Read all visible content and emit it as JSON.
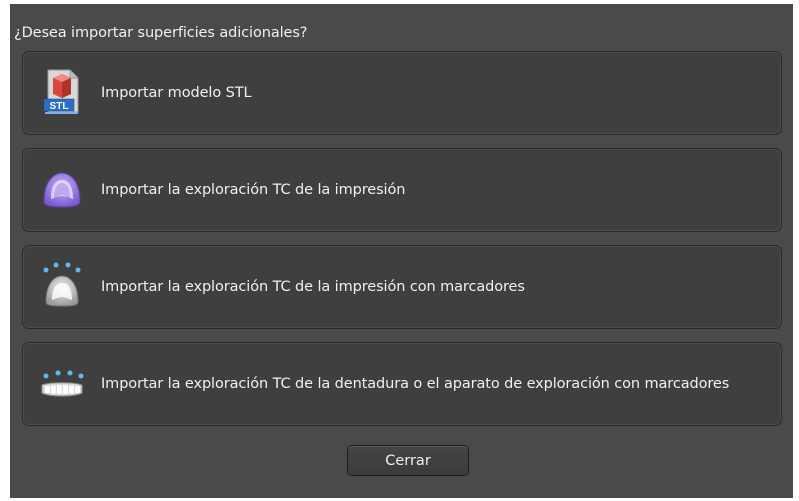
{
  "dialog": {
    "question": "¿Desea importar superficies adicionales?",
    "options": [
      {
        "label": "Importar modelo STL",
        "icon": "stl-file-icon",
        "icon_text": "STL"
      },
      {
        "label": "Importar la exploración TC de la impresión",
        "icon": "impression-tray-icon"
      },
      {
        "label": "Importar la exploración TC de la impresión con marcadores",
        "icon": "impression-markers-icon"
      },
      {
        "label": "Importar la exploración TC de la dentadura o el aparato de exploración con marcadores",
        "icon": "denture-markers-icon"
      }
    ],
    "close_label": "Cerrar"
  },
  "colors": {
    "dialog_bg": "#4a4a4a",
    "option_bg": "#3f3f3f",
    "text": "#f0f0f0",
    "stl_red": "#d9473f",
    "stl_blue": "#2b6fc4",
    "impression_purple": "#9d7fe0",
    "marker_blue": "#5fb8f0"
  }
}
